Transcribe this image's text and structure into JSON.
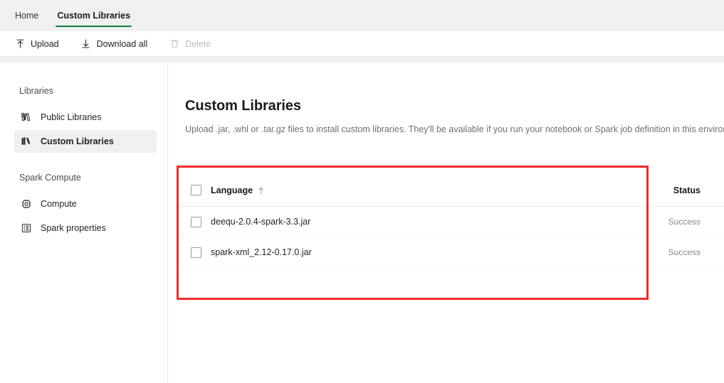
{
  "tabs": [
    {
      "label": "Home",
      "active": false,
      "name": "tab-home"
    },
    {
      "label": "Custom Libraries",
      "active": true,
      "name": "tab-custom-libraries"
    }
  ],
  "toolbar": {
    "upload_label": "Upload",
    "upload_icon": "upload-arrow-icon",
    "download_label": "Download all",
    "download_icon": "download-arrow-icon",
    "delete_label": "Delete",
    "delete_icon": "trash-icon",
    "delete_disabled": true
  },
  "sidebar": {
    "group_libraries": "Libraries",
    "group_spark_compute": "Spark Compute",
    "items": [
      {
        "label": "Public Libraries",
        "icon": "books-open-icon",
        "selected": false
      },
      {
        "label": "Custom Libraries",
        "icon": "books-stack-icon",
        "selected": true
      },
      {
        "label": "Compute",
        "icon": "cpu-chip-icon",
        "selected": false
      },
      {
        "label": "Spark properties",
        "icon": "list-table-icon",
        "selected": false
      }
    ]
  },
  "main": {
    "title": "Custom Libraries",
    "description": "Upload .jar, .whl or .tar.gz files to install custom libraries. They'll be available if you run your notebook or Spark job definition in this environment"
  },
  "table": {
    "columns": {
      "language": "Language",
      "status": "Status"
    },
    "sort": {
      "column": "Language",
      "direction": "ascending",
      "glyph": "↑"
    },
    "rows": [
      {
        "name": "deequ-2.0.4-spark-3.3.jar",
        "status": "Success",
        "checked": false
      },
      {
        "name": "spark-xml_2.12-0.17.0.jar",
        "status": "Success",
        "checked": false
      }
    ]
  },
  "annotation": {
    "shape": "rectangle",
    "color": "#ee2b2b",
    "target": "custom-libraries-table"
  },
  "colors": {
    "accent_tab_underline": "#107c41",
    "chrome_background": "#f0f0f0",
    "annotation_red": "#ee2b2b",
    "selected_nav_background": "#f0f0f0"
  }
}
